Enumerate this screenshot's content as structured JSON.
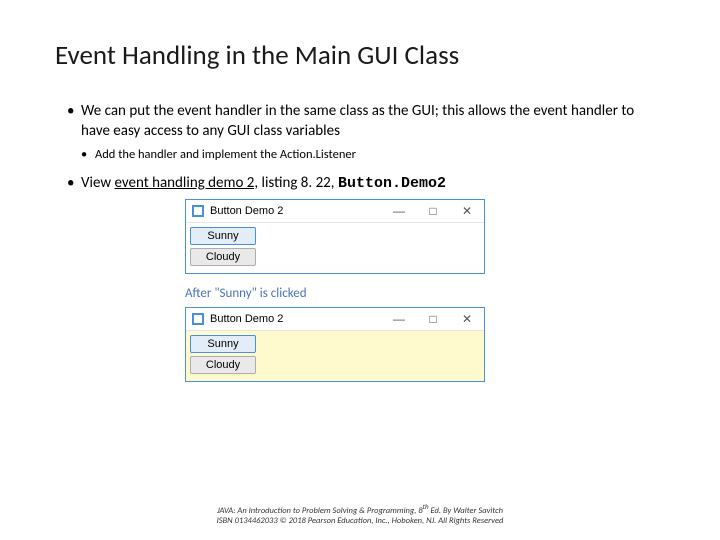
{
  "title": "Event Handling in the Main GUI Class",
  "bullets": {
    "b1a": "We can put the event handler in the same class as the GUI; this allows the event handler to have easy access to any GUI class variables",
    "b2a": "Add the handler and implement the Action.Listener",
    "b1b_pre": "View ",
    "b1b_link": "event handling demo 2,",
    "b1b_mid": " listing 8. 22, ",
    "b1b_code": "Button.Demo2"
  },
  "window1": {
    "title": "Button Demo 2",
    "btn1": "Sunny",
    "btn2": "Cloudy",
    "min": "—",
    "max": "□",
    "close": "✕"
  },
  "caption": "After \"Sunny\" is clicked",
  "window2": {
    "title": "Button Demo 2",
    "btn1": "Sunny",
    "btn2": "Cloudy",
    "min": "—",
    "max": "□",
    "close": "✕"
  },
  "footer": {
    "line1a": "JAVA: An Introduction to Problem Solving & Programming, 8",
    "line1sup": "th",
    "line1b": " Ed. By Walter Savitch",
    "line2": "ISBN 0134462033 © 2018 Pearson Education, Inc., Hoboken, NJ. All Rights Reserved"
  }
}
